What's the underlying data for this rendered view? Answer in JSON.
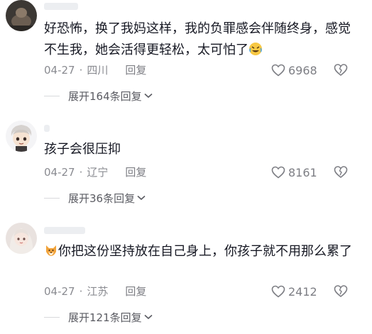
{
  "comments": [
    {
      "text": "好恐怖，换了我妈这样，我的负罪感会伴随终身，感觉不生我，她会活得更轻松，太可怕了",
      "emoji_after": "rolling-on-floor-laughing-emoji",
      "date": "04-27",
      "location": "四川",
      "reply_label": "回复",
      "likes": "6968",
      "expand_label": "展开164条回复"
    },
    {
      "text": "孩子会很压抑",
      "date": "04-27",
      "location": "辽宁",
      "reply_label": "回复",
      "likes": "8161",
      "expand_label": "展开36条回复"
    },
    {
      "emoji_before": "fox-emoji",
      "text": "你把这份坚持放在自己身上，你孩子就不用那么累了",
      "date": "04-27",
      "location": "江苏",
      "reply_label": "回复",
      "likes": "2412",
      "expand_label": "展开121条回复"
    }
  ],
  "meta_separator": "·",
  "colors": {
    "text": "#161823",
    "meta": "#8a8b91",
    "divider": "#d8d9dc"
  }
}
